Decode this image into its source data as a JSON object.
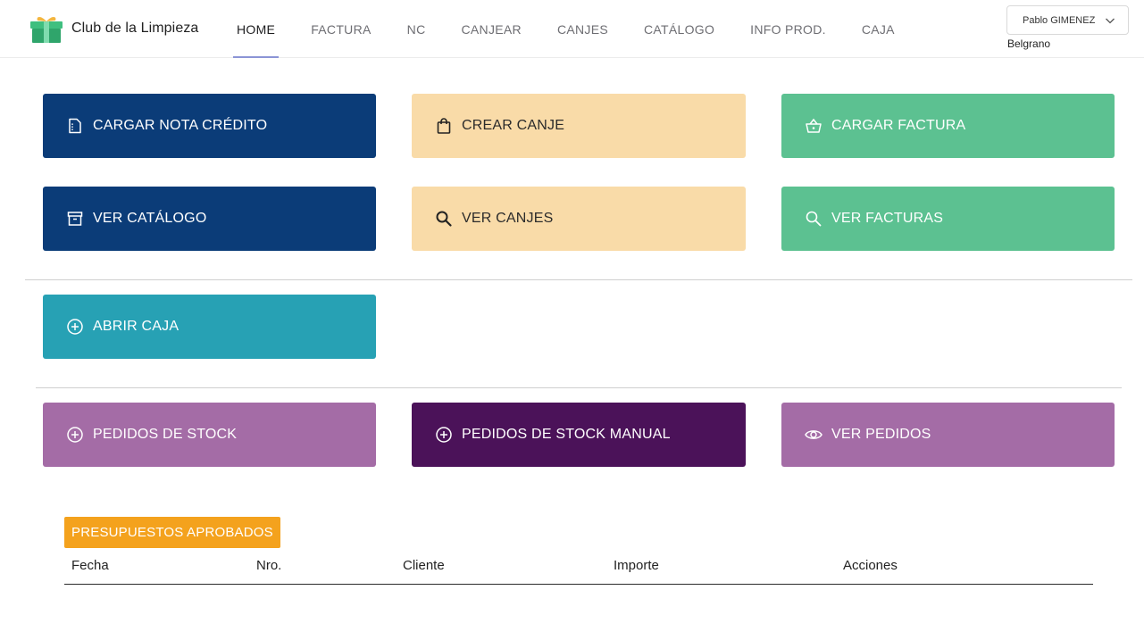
{
  "app": {
    "name": "Club de la Limpieza",
    "logo_icon": "gift-icon"
  },
  "nav": {
    "items": [
      {
        "label": "HOME",
        "active": true
      },
      {
        "label": "FACTURA",
        "active": false
      },
      {
        "label": "NC",
        "active": false
      },
      {
        "label": "CANJEAR",
        "active": false
      },
      {
        "label": "CANJES",
        "active": false
      },
      {
        "label": "CATÁLOGO",
        "active": false
      },
      {
        "label": "INFO PROD.",
        "active": false
      },
      {
        "label": "CAJA",
        "active": false
      }
    ]
  },
  "user": {
    "selected": "Pablo GIMENEZ",
    "branch": "Belgrano"
  },
  "actions": {
    "cargar_nota_credito": {
      "label": "CARGAR NOTA CRÉDITO",
      "icon": "document-icon",
      "color": "#0b3c78"
    },
    "crear_canje": {
      "label": "CREAR CANJE",
      "icon": "shopping-bag-icon",
      "color": "#f9dba8"
    },
    "cargar_factura": {
      "label": "CARGAR FACTURA",
      "icon": "basket-icon",
      "color": "#5cc191"
    },
    "ver_catalogo": {
      "label": "VER CATÁLOGO",
      "icon": "archive-icon",
      "color": "#0b3c78"
    },
    "ver_canjes": {
      "label": "VER CANJES",
      "icon": "search-icon",
      "color": "#f9dba8"
    },
    "ver_facturas": {
      "label": "VER FACTURAS",
      "icon": "search-icon",
      "color": "#5cc191"
    },
    "abrir_caja": {
      "label": "ABRIR CAJA",
      "icon": "plus-circle-icon",
      "color": "#27a1b4"
    },
    "pedidos_stock": {
      "label": "PEDIDOS DE STOCK",
      "icon": "plus-circle-icon",
      "color": "#a46ca6"
    },
    "pedidos_stock_manual": {
      "label": "PEDIDOS DE STOCK MANUAL",
      "icon": "plus-circle-icon",
      "color": "#4b1259"
    },
    "ver_pedidos": {
      "label": "VER PEDIDOS",
      "icon": "eye-icon",
      "color": "#a46ca6"
    }
  },
  "budgets": {
    "title": "PRESUPUESTOS APROBADOS",
    "title_color": "#f4a21d",
    "columns": [
      "Fecha",
      "Nro.",
      "Cliente",
      "Importe",
      "Acciones"
    ],
    "rows": []
  }
}
